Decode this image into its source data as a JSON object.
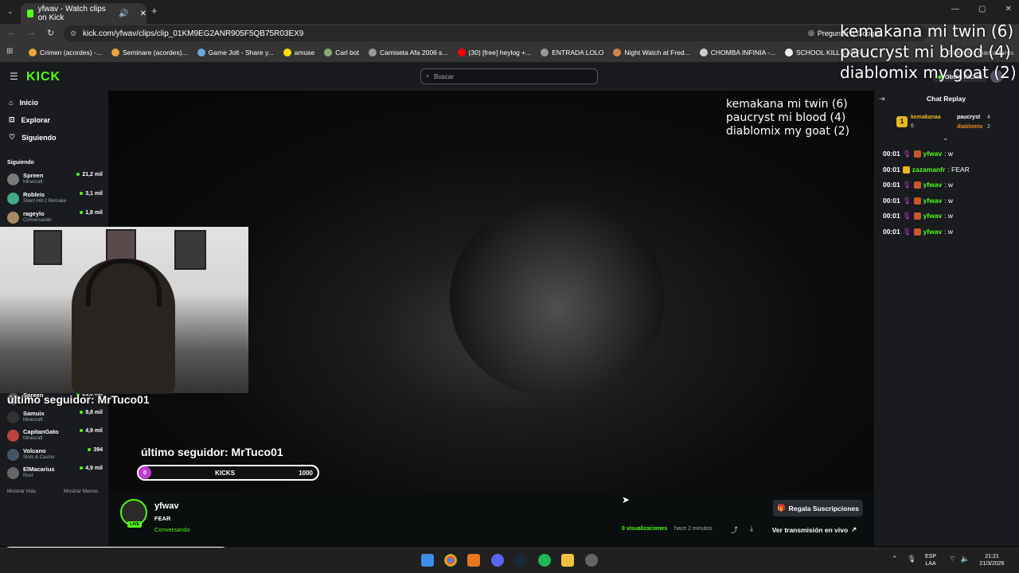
{
  "browser": {
    "tab_title": "yfwav - Watch clips on Kick",
    "url": "kick.com/yfwav/clips/clip_01KM9EG2ANR905F5QB75R03EX9",
    "ask_google": "Preguntar a Google",
    "bookmarks": [
      "Crimen (acordes) -...",
      "Seminare (acordes)...",
      "Game Jolt - Share y...",
      "amuse",
      "Carl bot",
      "Camiseta Afa 2006 s...",
      "(30) [free] heylog +...",
      "ENTRADA LOLO",
      "Night Watch at Fred...",
      "CHOMBA INFINIA -...",
      "SCHOOL KILLS ARTI...",
      "Todos los marcadores"
    ]
  },
  "header": {
    "logo": "KICK",
    "search_placeholder": "Buscar",
    "get_kicks": "Obtén KICKS"
  },
  "nav": [
    "Inicio",
    "Explorar",
    "Siguiendo"
  ],
  "following": {
    "title": "Siguiendo",
    "channels": [
      {
        "name": "Spreen",
        "category": "Minecraft",
        "viewers": "21,2 mil"
      },
      {
        "name": "Robleis",
        "category": "Silent Hill 2 Remake",
        "viewers": "3,1 mil"
      },
      {
        "name": "rageylo",
        "category": "Conversando",
        "viewers": "1,8 mil"
      },
      {
        "name": "Spreen",
        "category": "",
        "viewers": "21,6 mil"
      },
      {
        "name": "Samuix",
        "category": "Minecraft",
        "viewers": "9,8 mil"
      },
      {
        "name": "CapitanGato",
        "category": "Minecraft",
        "viewers": "4,9 mil"
      },
      {
        "name": "Volcano",
        "category": "Slots & Casino",
        "viewers": "394"
      },
      {
        "name": "ElMacarius",
        "category": "Rust",
        "viewers": "4,9 mil"
      }
    ],
    "show_more": "Mostrar más",
    "show_less": "Mostrar Menos"
  },
  "overlay": {
    "top_chatters": [
      "kemakana mi twin (6)",
      "paucryst mi blood (4)",
      "diablomix my goat (2)"
    ],
    "last_follower": "último seguidor: MrTuco01",
    "kicks_label": "KICKS",
    "kicks_min": "0",
    "kicks_max": "1000"
  },
  "chat": {
    "title": "Chat Replay",
    "leaderboard": [
      {
        "rank": "1",
        "name": "kemakanaa",
        "count": "6"
      },
      {
        "name": "paucryst",
        "count": "4"
      },
      {
        "name": "diablomix",
        "count": "2"
      }
    ],
    "messages": [
      {
        "time": "00:01",
        "user": "yfwav",
        "text": ": w",
        "color": "#53fc18"
      },
      {
        "time": "00:01",
        "user": "zazamanfr",
        "text": ": FEAR",
        "color": "#53fc18"
      },
      {
        "time": "00:01",
        "user": "yfwav",
        "text": ": w",
        "color": "#53fc18"
      },
      {
        "time": "00:01",
        "user": "yfwav",
        "text": ": w",
        "color": "#53fc18"
      },
      {
        "time": "00:01",
        "user": "yfwav",
        "text": ": w",
        "color": "#53fc18"
      },
      {
        "time": "00:01",
        "user": "yfwav",
        "text": ": w",
        "color": "#53fc18"
      }
    ]
  },
  "clip": {
    "channel": "yfwav",
    "title": "FEAR",
    "category": "Conversando",
    "live_badge": "LIVE",
    "views": "0 visualizaciones",
    "time_ago": "hace 2 minutos",
    "gift_subs": "Regala Suscripciones",
    "watch_live": "Ver transmisión en vivo"
  },
  "taskbar": {
    "lang_top": "ESP",
    "lang_bottom": "LAA",
    "time": "21:21",
    "date": "21/3/2026"
  },
  "colors": {
    "brand": "#53fc18",
    "kicks": "#c03bd0"
  }
}
